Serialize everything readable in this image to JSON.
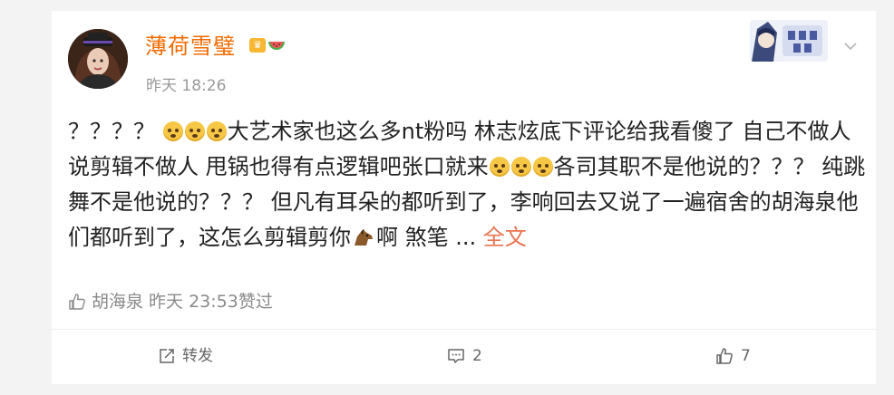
{
  "post": {
    "username": "薄荷雪璧",
    "timestamp": "昨天 18:26",
    "text_1": "？？？？ ",
    "text_2": "大艺术家也这么多nt粉吗 林志炫底下评论给我看傻了 自己不做人说剪辑不做人 甩锅也得有点逻辑吧张口就来",
    "text_3": "各司其职不是他说的？？？ 纯跳舞不是他说的？？？ 但凡有耳朵的都听到了，李响回去又说了一遍宿舍的胡海泉他们都听到了，这怎么剪辑剪你",
    "text_4": "啊 煞笔 ... ",
    "full_text_link": "全文",
    "liked_by": "胡海泉 昨天 23:53赞过",
    "badges": [
      "crown-badge-icon",
      "watermelon-badge-icon"
    ]
  },
  "actions": {
    "share_label": "转发",
    "comment_count": "2",
    "like_count": "7"
  },
  "colors": {
    "username": "#f56a00",
    "link": "#eb7350",
    "meta": "#9a9a9a"
  }
}
